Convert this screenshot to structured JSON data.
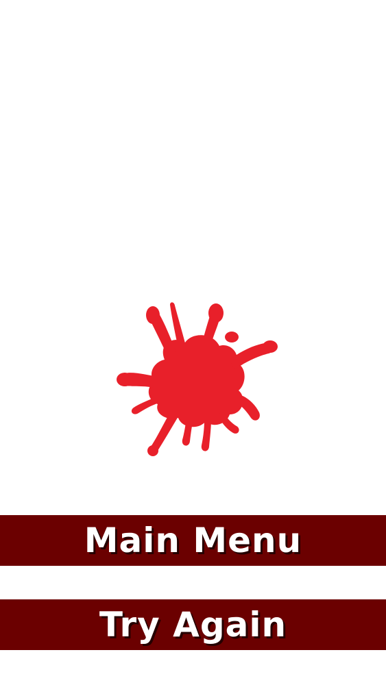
{
  "colors": {
    "background": "#ffffff",
    "button_bg": "#6b0000",
    "button_text": "#ffffff",
    "splat": "#e8202a"
  },
  "icons": {
    "splat": "paint-splat-icon"
  },
  "buttons": {
    "main_menu": "Main Menu",
    "try_again": "Try Again"
  }
}
